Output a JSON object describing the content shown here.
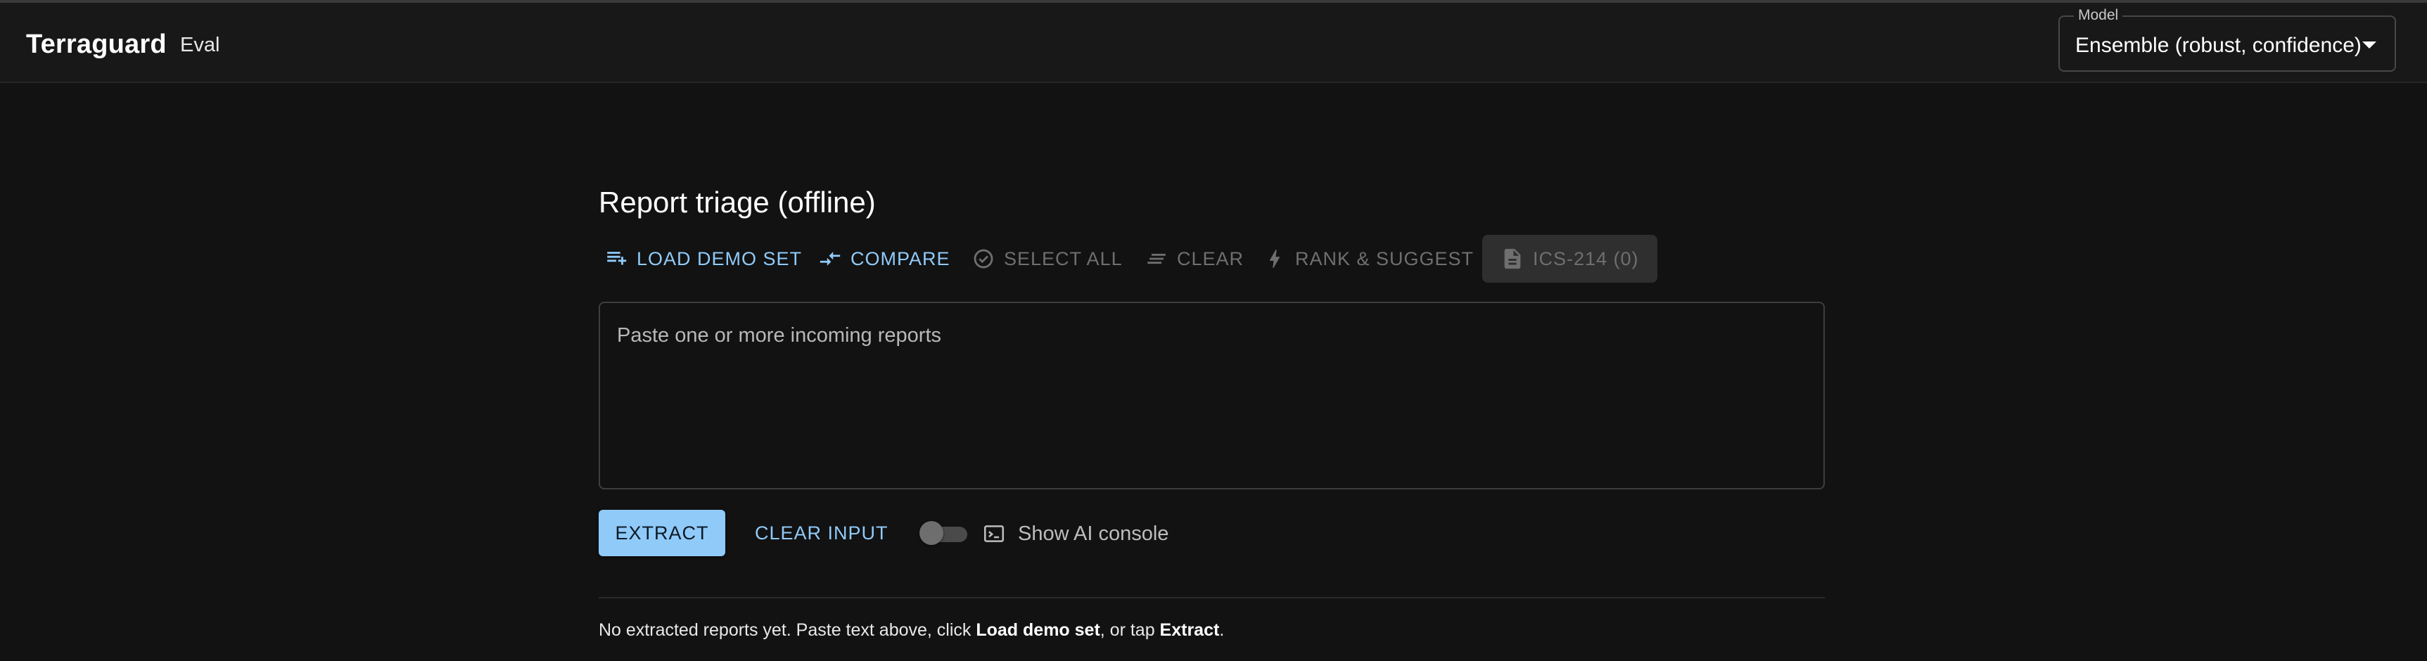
{
  "app": {
    "title": "Terraguard",
    "subtitle": "Eval"
  },
  "model": {
    "label": "Model",
    "value": "Ensemble (robust, confidence)"
  },
  "page": {
    "title": "Report triage (offline)"
  },
  "toolbar": {
    "load_demo": "LOAD DEMO SET",
    "compare": "COMPARE",
    "select_all": "SELECT ALL",
    "clear": "CLEAR",
    "rank_suggest": "RANK & SUGGEST",
    "ics": "ICS-214 (0)"
  },
  "input": {
    "placeholder": "Paste one or more incoming reports",
    "value": ""
  },
  "actions": {
    "extract": "EXTRACT",
    "clear_input": "CLEAR INPUT",
    "console_toggle_on": false,
    "console_label": "Show AI console"
  },
  "empty_state": {
    "prefix": "No extracted reports yet. Paste text above, click ",
    "load_demo": "Load demo set",
    "middle": ", or tap ",
    "extract": "Extract",
    "suffix": "."
  },
  "colors": {
    "accent": "#90caf9",
    "background": "#121212",
    "disabled": "#6f6f6f"
  }
}
